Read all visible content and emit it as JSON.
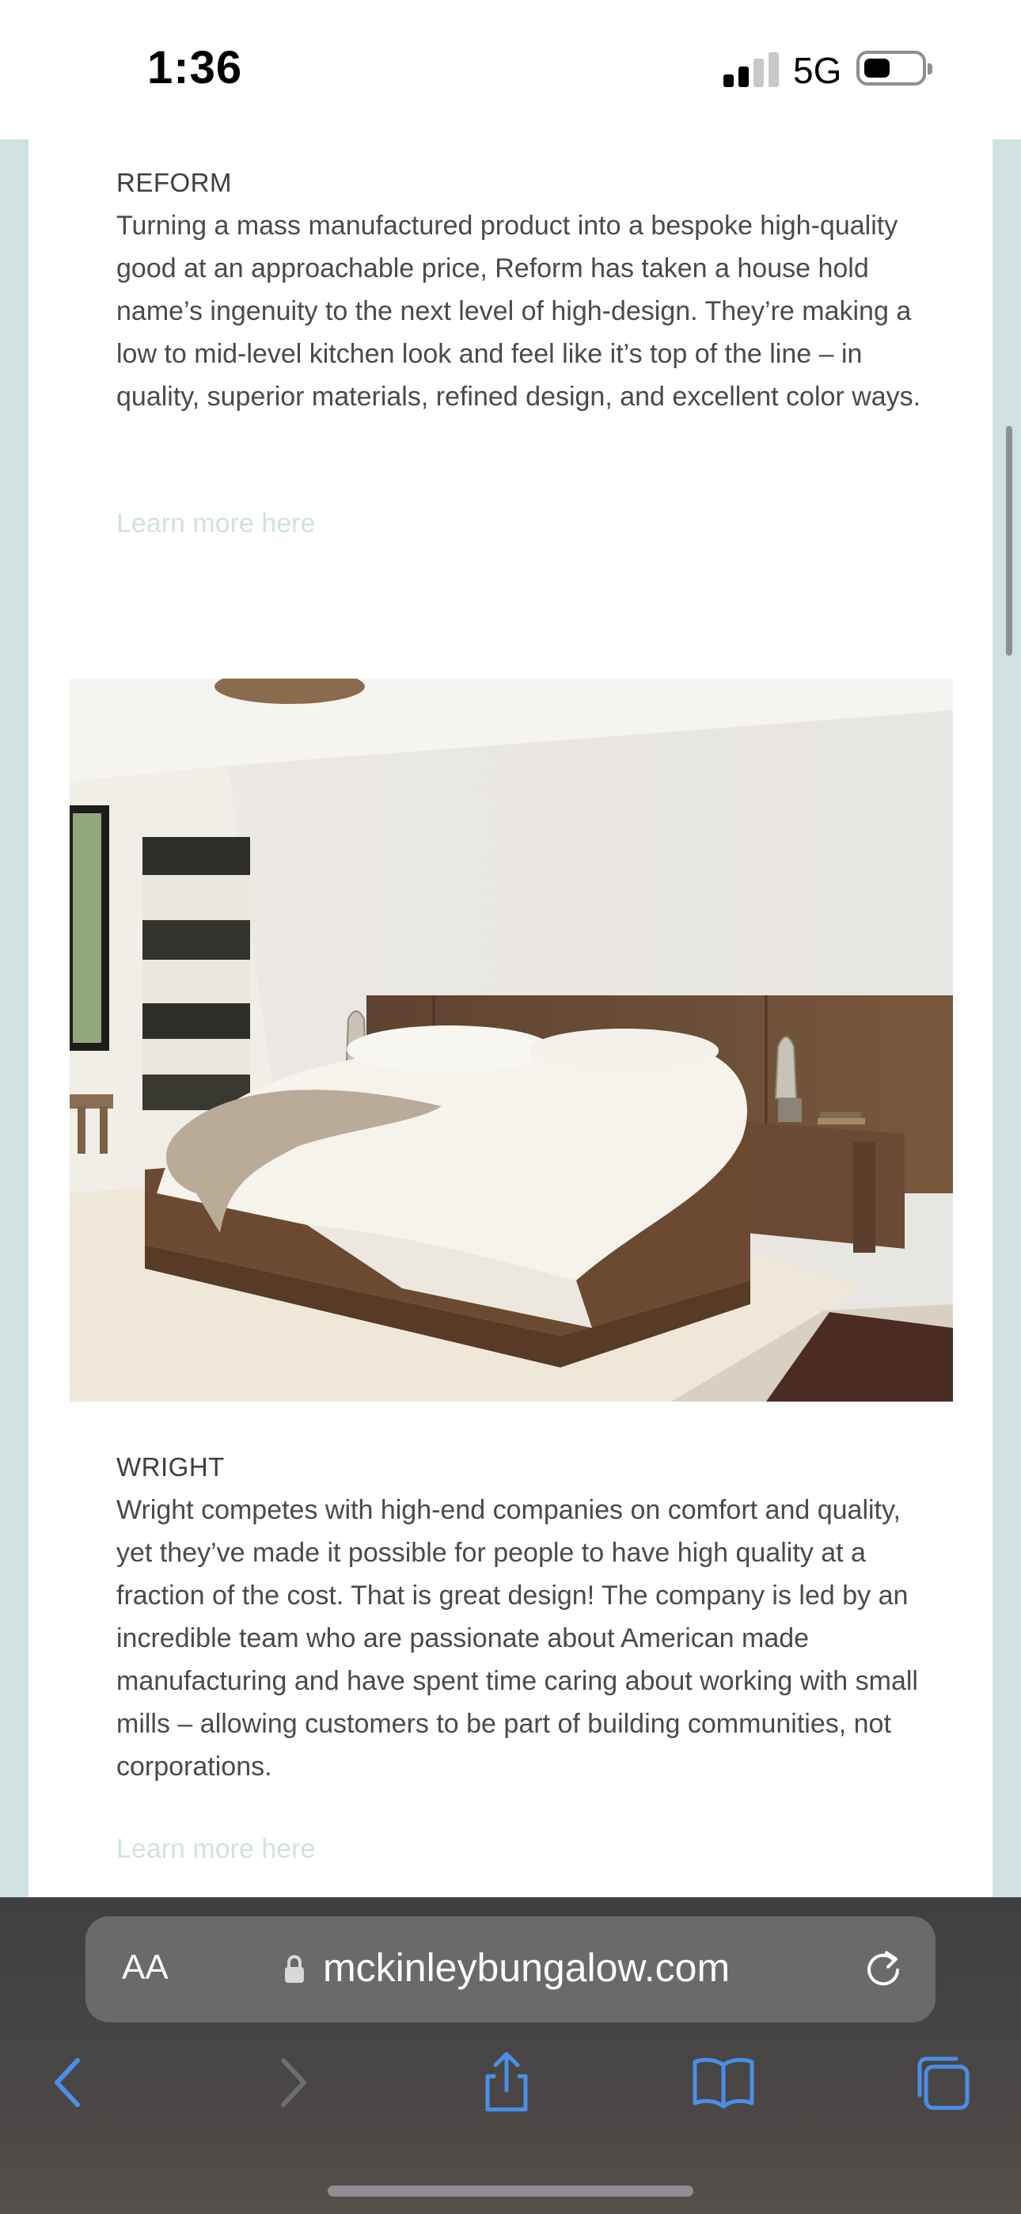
{
  "status_bar": {
    "time": "1:36",
    "network": "5G",
    "battery_level": 0.45
  },
  "sections": [
    {
      "heading": "REFORM",
      "body": "Turning a mass manufactured product into a bespoke high-quality good at an approachable price, Reform has taken a house hold name’s ingenuity to the next level of high-design. They’re making a low to mid-level kitchen look and feel like it’s top of the line – in quality, superior materials, refined design, and excellent color ways.",
      "link": "Learn more here"
    },
    {
      "heading": "WRIGHT",
      "body": "Wright competes with high-end companies on comfort and quality, yet they’ve made it possible for people to have high quality at a fraction of the cost. That is great design! The company is led by an incredible team who are passionate about American made manufacturing and have spent time caring about working with small mills – allowing customers to be part of building communities, not corporations.",
      "link": "Learn more here"
    }
  ],
  "browser": {
    "text_size_label": "AA",
    "url": "mckinleybungalow.com"
  },
  "colors": {
    "accent": "#cfe2e0",
    "toolbar_blue": "#4a8fe7"
  },
  "icons": [
    "signal-icon",
    "battery-icon",
    "lock-icon",
    "reload-icon",
    "back-icon",
    "forward-icon",
    "share-icon",
    "bookmarks-icon",
    "tabs-icon"
  ]
}
